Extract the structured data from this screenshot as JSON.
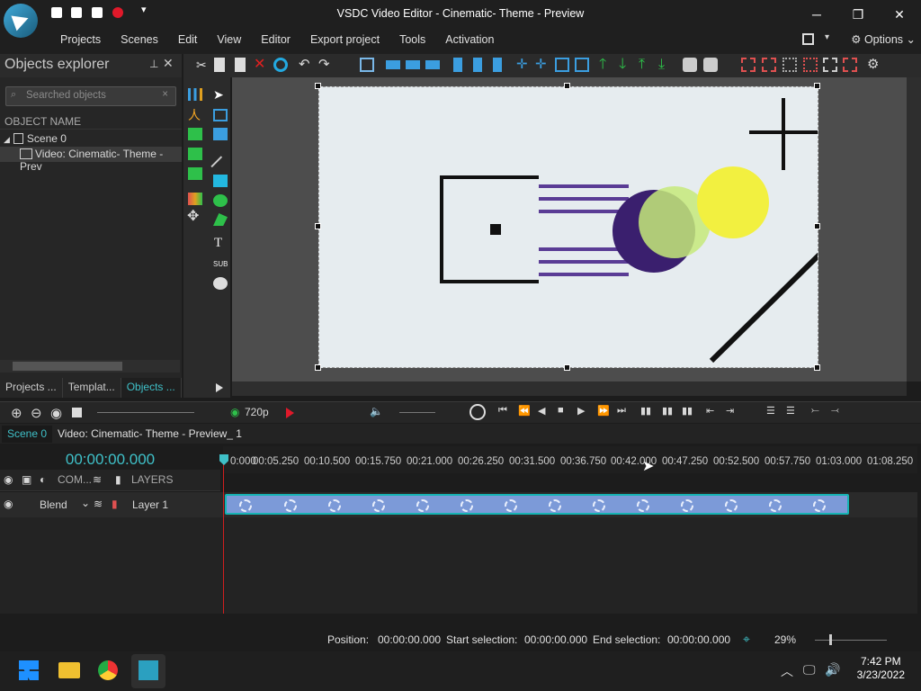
{
  "window": {
    "title": "VSDC Video Editor - Cinematic- Theme - Preview",
    "minimize": "─",
    "restore": "❐",
    "close": "✕"
  },
  "menu": [
    "Projects",
    "Scenes",
    "Edit",
    "View",
    "Editor",
    "Export project",
    "Tools",
    "Activation"
  ],
  "options_label": "Options",
  "objects_explorer": {
    "title": "Objects explorer",
    "search_placeholder": "Searched objects",
    "column_header": "OBJECT NAME",
    "tree": [
      {
        "label": "Scene 0"
      },
      {
        "label": "Video: Cinematic- Theme - Prev"
      }
    ],
    "tabs": [
      "Projects ...",
      "Templat...",
      "Objects ..."
    ]
  },
  "preview": {
    "resolution": "720p"
  },
  "scene_tabs": [
    "Scene 0",
    "Video: Cinematic- Theme - Preview_ 1"
  ],
  "timeline": {
    "time": "00:00:00.000",
    "ruler_ticks": [
      "0:000",
      "00:05.250",
      "00:10.500",
      "00:15.750",
      "00:21.000",
      "00:26.250",
      "00:31.500",
      "00:36.750",
      "00:42.000",
      "00:47.250",
      "00:52.500",
      "00:57.750",
      "01:03.000",
      "01:08.250"
    ],
    "layers_header": {
      "com": "COM...",
      "layers": "LAYERS"
    },
    "track": {
      "blend": "Blend",
      "layer": "Layer 1"
    }
  },
  "status": {
    "position_label": "Position:",
    "position": "00:00:00.000",
    "start_label": "Start selection:",
    "start": "00:00:00.000",
    "end_label": "End selection:",
    "end": "00:00:00.000",
    "zoom": "29%"
  },
  "taskbar": {
    "time": "7:42 PM",
    "date": "3/23/2022"
  },
  "colors": {
    "accent": "#3fc0c8",
    "clip": "#7c9ad8",
    "clip_border": "#16b3b3",
    "playhead": "#d01e1e"
  }
}
